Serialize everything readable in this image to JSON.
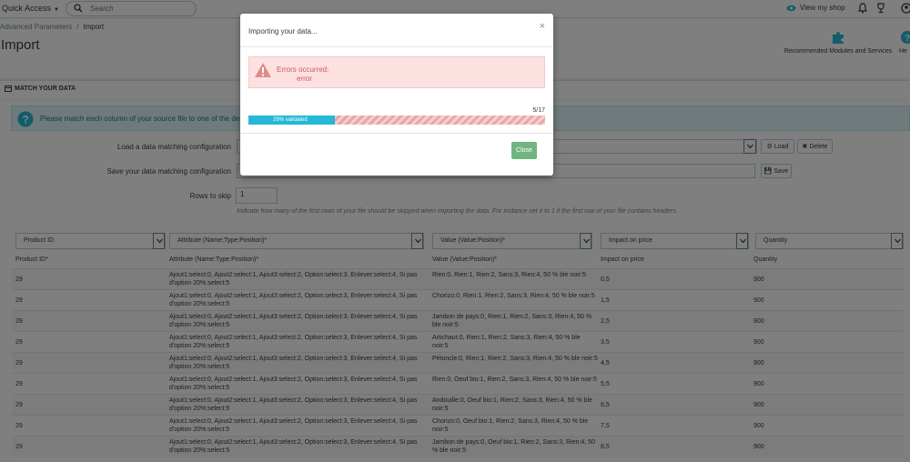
{
  "topbar": {
    "quick_access": "Quick Access",
    "search_placeholder": "Search",
    "view_shop": "View my shop"
  },
  "header": {
    "breadcrumb": [
      "Advanced Parameters",
      "Import"
    ],
    "title": "Import",
    "recommended": "Recommended Modules and Services",
    "help": "He"
  },
  "panel": {
    "heading": "MATCH YOUR DATA",
    "info": "Please match each column of your source file to one of the destination",
    "load_label": "Load a data matching configuration",
    "save_label": "Save your data matching configuration",
    "skip_label": "Rows to skip",
    "skip_value": "1",
    "load_btn": "Load",
    "delete_btn": "Delete",
    "save_btn": "Save",
    "help_text": "Indicate how many of the first rows of your file should be skipped when importing the data. For instance set it to 1 if the first row of your file contains headers."
  },
  "table": {
    "selects": [
      "Product ID",
      "Attribute (Name:Type:Position)*",
      "Value (Value:Position)*",
      "Impact on price",
      "Quantity"
    ],
    "headers": [
      "Product ID*",
      "Attribute (Name:Type:Position)*",
      "Value (Value:Position)*",
      "Impact on price",
      "Quantity"
    ],
    "rows": [
      {
        "id": "29",
        "attr": "Ajout1:select:0, Ajout2:select:1, Ajout3:select:2, Option:select:3, Enlever:select:4, Si pas d'option 20%:select:5",
        "value": "Rien:0, Rien:1, Rien:2, Sans:3, Rien:4, 50 % ble noir:5",
        "price": "0,5",
        "qty": "900"
      },
      {
        "id": "29",
        "attr": "Ajout1:select:0, Ajout2:select:1, Ajout3:select:2, Option:select:3, Enlever:select:4, Si pas d'option 20%:select:5",
        "value": "Chorizo:0, Rien:1, Rien:2, Sans:3, Rien:4, 50 % ble noir:5",
        "price": "1,5",
        "qty": "900"
      },
      {
        "id": "29",
        "attr": "Ajout1:select:0, Ajout2:select:1, Ajout3:select:2, Option:select:3, Enlever:select:4, Si pas d'option 20%:select:5",
        "value": "Jambon de pays:0, Rien:1, Rien:2, Sans:3, Rien:4, 50 % ble noir:5",
        "price": "2,5",
        "qty": "900"
      },
      {
        "id": "29",
        "attr": "Ajout1:select:0, Ajout2:select:1, Ajout3:select:2, Option:select:3, Enlever:select:4, Si pas d'option 20%:select:5",
        "value": "Artichaut:0, Rien:1, Rien:2, Sans:3, Rien:4, 50 % ble noir:5",
        "price": "3,5",
        "qty": "900"
      },
      {
        "id": "29",
        "attr": "Ajout1:select:0, Ajout2:select:1, Ajout3:select:2, Option:select:3, Enlever:select:4, Si pas d'option 20%:select:5",
        "value": "Pétoncle:0, Rien:1, Rien:2, Sans:3, Rien:4, 50 % ble noir:5",
        "price": "4,5",
        "qty": "900"
      },
      {
        "id": "29",
        "attr": "Ajout1:select:0, Ajout2:select:1, Ajout3:select:2, Option:select:3, Enlever:select:4, Si pas d'option 20%:select:5",
        "value": "Rien:0, Oeuf bio:1, Rien:2, Sans:3, Rien:4, 50 % ble noir:5",
        "price": "5,5",
        "qty": "900"
      },
      {
        "id": "29",
        "attr": "Ajout1:select:0, Ajout2:select:1, Ajout3:select:2, Option:select:3, Enlever:select:4, Si pas d'option 20%:select:5",
        "value": "Andouille:0, Oeuf bio:1, Rien:2, Sans:3, Rien:4, 50 % ble noir:5",
        "price": "6,5",
        "qty": "900"
      },
      {
        "id": "29",
        "attr": "Ajout1:select:0, Ajout2:select:1, Ajout3:select:2, Option:select:3, Enlever:select:4, Si pas d'option 20%:select:5",
        "value": "Chorizo:0, Oeuf bio:1, Rien:2, Sans:3, Rien:4, 50 % ble noir:5",
        "price": "7,5",
        "qty": "900"
      },
      {
        "id": "29",
        "attr": "Ajout1:select:0, Ajout2:select:1, Ajout3:select:2, Option:select:3, Enlever:select:4, Si pas d'option 20%:select:5",
        "value": "Jambon de pays:0, Oeuf bio:1, Rien:2, Sans:3, Rien:4, 50 % ble noir:5",
        "price": "8,5",
        "qty": "900"
      }
    ]
  },
  "modal": {
    "title": "Importing your data...",
    "close_x": "×",
    "error_title": "Errors occurred:",
    "error_msg": "error",
    "progress_count": "5/17",
    "progress_label": "29% validated",
    "progress_fraction": 0.29,
    "close_btn": "Close"
  },
  "colors": {
    "accent": "#25b9d7",
    "success": "#70b580",
    "danger_bg": "#fde1e1",
    "danger_text": "#c45c5c"
  }
}
